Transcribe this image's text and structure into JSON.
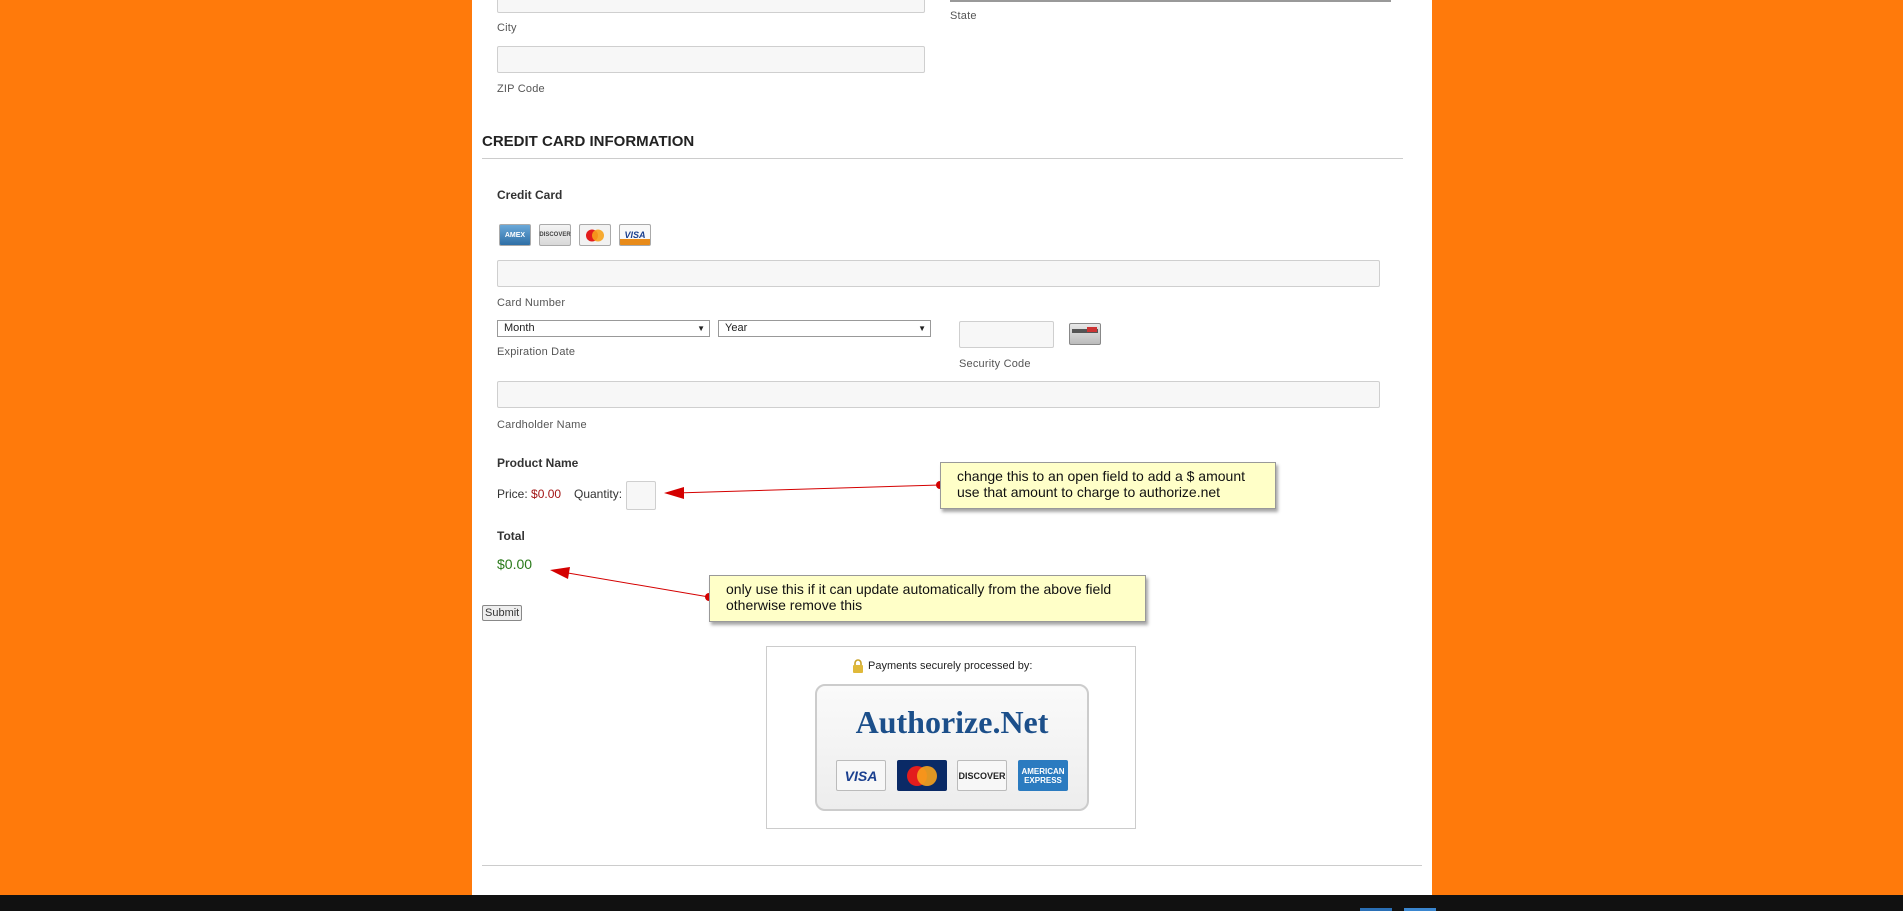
{
  "address": {
    "city_label": "City",
    "state_label": "State",
    "zip_label": "ZIP Code"
  },
  "credit_card_section": {
    "title": "CREDIT CARD INFORMATION",
    "field_title": "Credit Card",
    "card_logos": [
      "AMEX",
      "DISCOVER",
      "MC",
      "VISA"
    ],
    "card_number_label": "Card Number",
    "month_value": "Month",
    "year_value": "Year",
    "expiration_label": "Expiration Date",
    "security_code_label": "Security Code",
    "cardholder_label": "Cardholder Name"
  },
  "product": {
    "title": "Product Name",
    "price_label": "Price:",
    "price_value": "$0.00",
    "quantity_label": "Quantity:"
  },
  "total": {
    "title": "Total",
    "value": "$0.00"
  },
  "submit_label": "Submit",
  "annotations": {
    "note1_line1": "change this to an open field to add a $ amount",
    "note1_line2": "use that amount to charge to authorize.net",
    "note2_line1": "only use this if it can update automatically from the above field",
    "note2_line2": "otherwise remove this"
  },
  "seal": {
    "processed_text": "Payments securely processed by:",
    "brand": "Authorize.Net",
    "logos": [
      "VISA",
      "MasterCard",
      "DISCOVER",
      "AMERICAN EXPRESS"
    ]
  },
  "colors": {
    "background": "#ff7a0b",
    "price_red": "#a31515",
    "total_green": "#2a7a1a",
    "arrow_red": "#d40000",
    "brand_blue": "#1c4f8a"
  }
}
